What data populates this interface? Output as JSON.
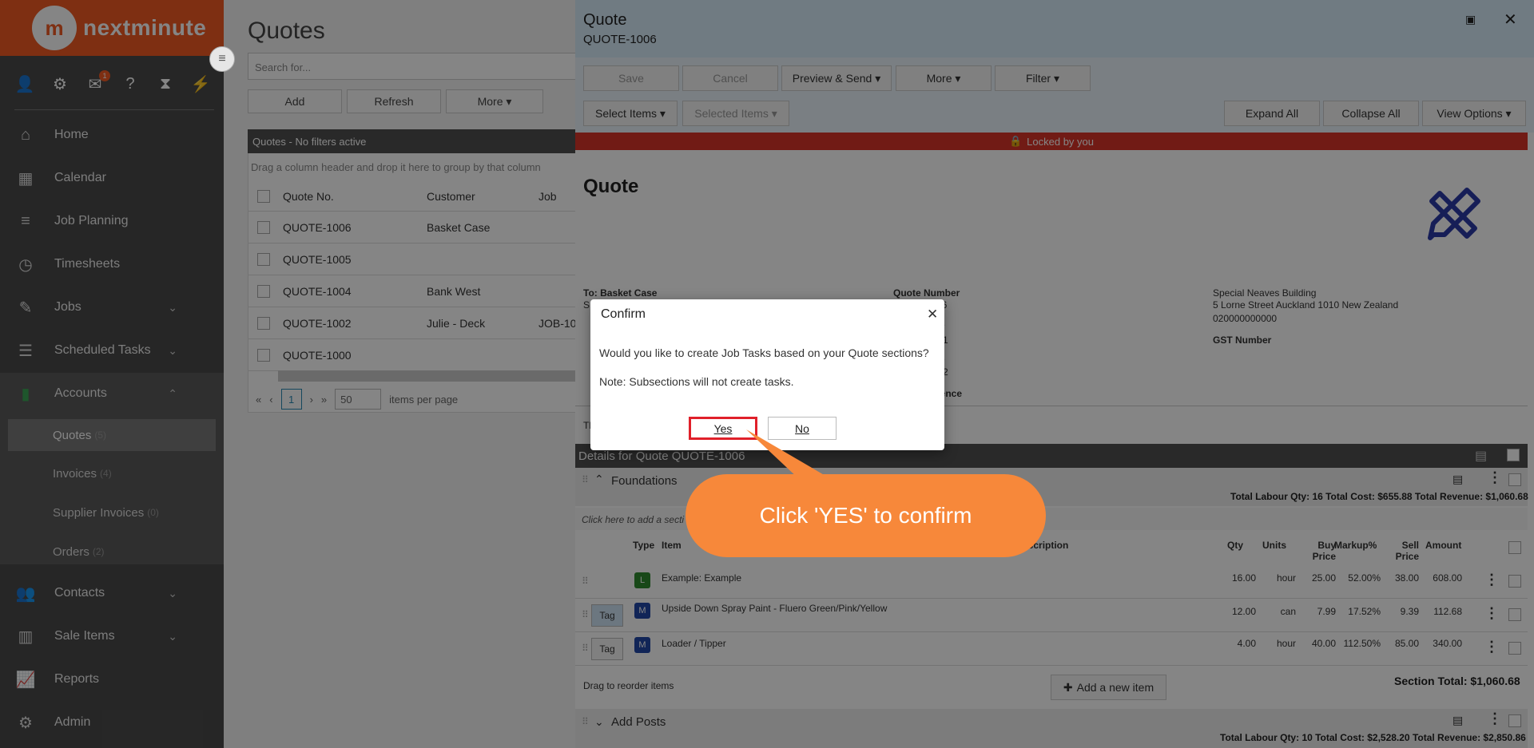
{
  "app": {
    "logo_text": "nextminute",
    "logo_mark": "m",
    "brand_color": "#f15a24"
  },
  "sidebar": {
    "toolbar_icons": [
      {
        "name": "user-icon",
        "glyph": "👤"
      },
      {
        "name": "gear-icon",
        "glyph": "⚙"
      },
      {
        "name": "mail-icon",
        "glyph": "✉",
        "badge": "1"
      },
      {
        "name": "help-icon",
        "glyph": "?"
      },
      {
        "name": "hourglass-icon",
        "glyph": "⧗"
      },
      {
        "name": "bolt-icon",
        "glyph": "⚡"
      }
    ],
    "items": [
      {
        "label": "Home",
        "icon": "home-icon",
        "glyph": "⌂"
      },
      {
        "label": "Calendar",
        "icon": "calendar-icon",
        "glyph": "▦"
      },
      {
        "label": "Job Planning",
        "icon": "list-icon",
        "glyph": "≡"
      },
      {
        "label": "Timesheets",
        "icon": "clock-icon",
        "glyph": "◷"
      },
      {
        "label": "Jobs",
        "icon": "wrench-icon",
        "glyph": "✎"
      },
      {
        "label": "Scheduled Tasks",
        "icon": "tasks-icon",
        "glyph": "☰"
      },
      {
        "label": "Accounts",
        "icon": "file-icon",
        "glyph": "▮"
      },
      {
        "label": "Contacts",
        "icon": "users-icon",
        "glyph": "👥"
      },
      {
        "label": "Sale Items",
        "icon": "barcode-icon",
        "glyph": "▥"
      },
      {
        "label": "Reports",
        "icon": "chart-icon",
        "glyph": "📈"
      },
      {
        "label": "Admin",
        "icon": "cog-icon",
        "glyph": "⚙"
      }
    ],
    "sub_items": [
      {
        "label": "Quotes",
        "count": "(5)"
      },
      {
        "label": "Invoices",
        "count": "(4)"
      },
      {
        "label": "Supplier Invoices",
        "count": "(0)"
      },
      {
        "label": "Orders",
        "count": "(2)"
      }
    ]
  },
  "quotes_list": {
    "title": "Quotes",
    "search_placeholder": "Search for...",
    "buttons": {
      "add": "Add",
      "refresh": "Refresh",
      "more": "More ▾"
    },
    "grid_title": "Quotes - No filters active",
    "group_hint": "Drag a column header and drop it here to group by that column",
    "columns": {
      "quote_no": "Quote No.",
      "customer": "Customer",
      "job": "Job"
    },
    "rows": [
      {
        "quote": "QUOTE-1006",
        "customer": "Basket Case",
        "job": ""
      },
      {
        "quote": "QUOTE-1005",
        "customer": "",
        "job": ""
      },
      {
        "quote": "QUOTE-1004",
        "customer": "Bank West",
        "job": ""
      },
      {
        "quote": "QUOTE-1002",
        "customer": "Julie - Deck",
        "job": "JOB-10"
      },
      {
        "quote": "QUOTE-1000",
        "customer": "",
        "job": ""
      }
    ],
    "pager": {
      "page": "1",
      "page_size": "50",
      "per_page_label": "items per page"
    }
  },
  "panel": {
    "title": "Quote",
    "subtitle": "QUOTE-1006",
    "toolbar": {
      "save": "Save",
      "cancel": "Cancel",
      "preview": "Preview & Send ▾",
      "more": "More ▾",
      "filter": "Filter ▾",
      "select_items": "Select Items ▾",
      "selected_items": "Selected Items ▾",
      "expand_all": "Expand All",
      "collapse_all": "Collapse All",
      "view_options": "View Options ▾"
    },
    "lock_text": "Locked by you",
    "doc": {
      "heading": "Quote",
      "to_label": "To: Basket Case",
      "quote_number_label": "Quote Number",
      "quote_number_partial": "06",
      "partial_a": "e",
      "partial_b": "1",
      "partial_c": "e",
      "partial_d": "2",
      "reference_partial": "rence",
      "company_name": "Special Neaves Building",
      "company_address": "5 Lorne Street Auckland 1010 New Zealand",
      "company_phone": "020000000000",
      "gst_label": "GST Number",
      "left_partial": "S",
      "left_partial2": "Th"
    },
    "details_title": "Details for Quote QUOTE-1006",
    "section1": {
      "name": "Foundations",
      "totals": "Total Labour Qty: 16   Total Cost: $655.88   Total Revenue: $1,060.68",
      "add_hint": "Click here to add a secti"
    },
    "item_columns": {
      "type": "Type",
      "item": "Item",
      "description": "escription",
      "qty": "Qty",
      "units": "Units",
      "buy": "Buy Price",
      "markup": "Markup%",
      "sell": "Sell Price",
      "amount": "Amount"
    },
    "items": [
      {
        "type": "L",
        "name": "Example: Example",
        "qty": "16.00",
        "units": "hour",
        "buy": "25.00",
        "markup": "52.00%",
        "sell": "38.00",
        "amount": "608.00",
        "tag": ""
      },
      {
        "type": "M",
        "name": "Upside Down Spray Paint - Fluero Green/Pink/Yellow",
        "qty": "12.00",
        "units": "can",
        "buy": "7.99",
        "markup": "17.52%",
        "sell": "9.39",
        "amount": "112.68",
        "tag": "Tag"
      },
      {
        "type": "M",
        "name": "Loader / Tipper",
        "qty": "4.00",
        "units": "hour",
        "buy": "40.00",
        "markup": "112.50%",
        "sell": "85.00",
        "amount": "340.00",
        "tag": "Tag"
      }
    ],
    "drag_hint": "Drag to reorder items",
    "add_item": "Add a new item",
    "section_total": "Section Total: $1,060.68",
    "section2": {
      "name": "Add Posts",
      "totals": "Total Labour Qty: 10   Total Cost: $2,528.20   Total Revenue: $2,850.86"
    }
  },
  "dialog": {
    "title": "Confirm",
    "question": "Would you like to create Job Tasks based on your Quote sections?",
    "note": "Note: Subsections will not create tasks.",
    "yes": "Yes",
    "no": "No"
  },
  "callout": {
    "text": "Click 'YES' to confirm",
    "color": "#f7883a"
  }
}
